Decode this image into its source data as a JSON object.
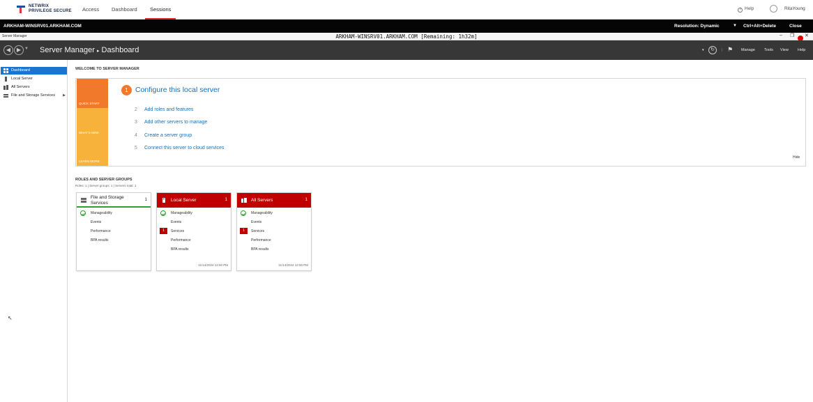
{
  "netwrix": {
    "brand_line1": "NETWRIX",
    "brand_line2": "PRIVILEGE SECURE",
    "nav": [
      "Access",
      "Dashboard",
      "Sessions"
    ],
    "active_nav": "Sessions",
    "help": "Help",
    "help_icon_glyph": "?",
    "user": "RitaYoung"
  },
  "session": {
    "host": "ARKHAM-WINSRV01.ARKHAM.COM",
    "resolution_label": "Resolution: Dynamic",
    "cad_label": "Ctrl+Alt+Delete",
    "close_label": "Close"
  },
  "rdp": {
    "app_name": "Server Manager",
    "title": "ARKHAM-WINSRV01.ARKHAM.COM [Remaining: 1h32m]"
  },
  "server_manager": {
    "title": "Server Manager",
    "page": "Dashboard",
    "menu": [
      "Manage",
      "Tools",
      "View",
      "Help"
    ]
  },
  "sidebar": {
    "items": [
      {
        "label": "Dashboard",
        "active": true
      },
      {
        "label": "Local Server",
        "active": false
      },
      {
        "label": "All Servers",
        "active": false
      },
      {
        "label": "File and Storage Services",
        "active": false
      }
    ]
  },
  "welcome": {
    "heading": "WELCOME TO SERVER MANAGER",
    "tiles": [
      "QUICK START",
      "WHAT'S NEW",
      "LEARN MORE"
    ],
    "main_step_num": "1",
    "main_step": "Configure this local server",
    "steps": [
      {
        "num": "2",
        "label": "Add roles and features"
      },
      {
        "num": "3",
        "label": "Add other servers to manage"
      },
      {
        "num": "4",
        "label": "Create a server group"
      },
      {
        "num": "5",
        "label": "Connect this server to cloud services"
      }
    ],
    "hide_label": "Hide"
  },
  "roles": {
    "heading": "ROLES AND SERVER GROUPS",
    "summary": "Roles: 1  |  Server groups: 1  |  Servers total: 1",
    "tiles": [
      {
        "name_line1": "File and Storage",
        "name_line2": "Services",
        "count": "1",
        "manageability": "Manageability",
        "events": "Events",
        "performance": "Performance",
        "bpa": "BPA results"
      },
      {
        "name": "Local Server",
        "count": "1",
        "manageability": "Manageability",
        "events": "Events",
        "services": "Services",
        "services_count": "1",
        "performance": "Performance",
        "bpa": "BPA results",
        "time": "11/14/2024 12:50 PM"
      },
      {
        "name": "All Servers",
        "count": "1",
        "manageability": "Manageability",
        "events": "Events",
        "services": "Services",
        "services_count": "1",
        "performance": "Performance",
        "bpa": "BPA results",
        "time": "11/14/2024 12:50 PM"
      }
    ]
  },
  "colors": {
    "accent_red": "#c00000",
    "nav_active": "#d32f2f",
    "sidebar_active": "#1b75cf",
    "quick_start": "#f0792b",
    "whats_new": "#f7b23b",
    "learn_more": "#f7b23b",
    "link_blue": "#1a6fb5",
    "ok_green": "#2ca02c"
  }
}
